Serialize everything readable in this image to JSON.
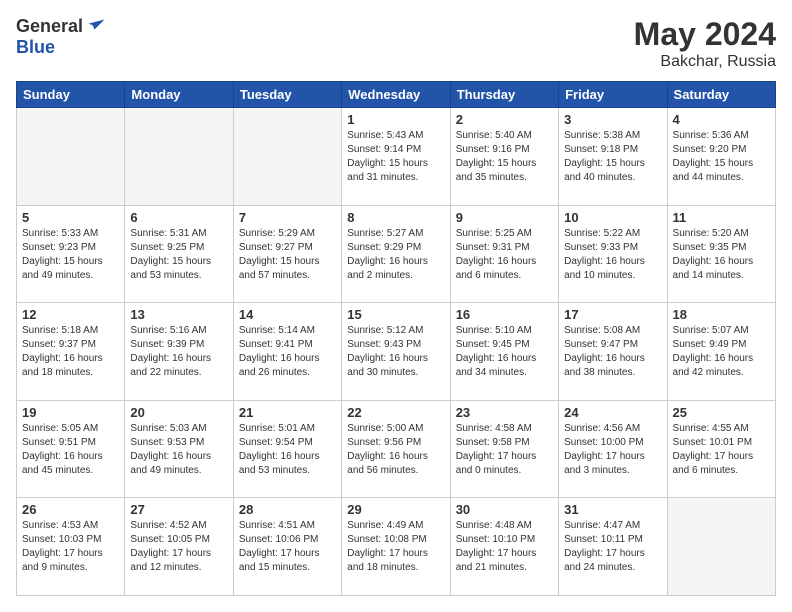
{
  "header": {
    "logo_general": "General",
    "logo_blue": "Blue",
    "month_year": "May 2024",
    "location": "Bakchar, Russia"
  },
  "days_of_week": [
    "Sunday",
    "Monday",
    "Tuesday",
    "Wednesday",
    "Thursday",
    "Friday",
    "Saturday"
  ],
  "weeks": [
    [
      {
        "day": "",
        "empty": true
      },
      {
        "day": "",
        "empty": true
      },
      {
        "day": "",
        "empty": true
      },
      {
        "day": "1",
        "sunrise": "5:43 AM",
        "sunset": "9:14 PM",
        "daylight": "15 hours and 31 minutes."
      },
      {
        "day": "2",
        "sunrise": "5:40 AM",
        "sunset": "9:16 PM",
        "daylight": "15 hours and 35 minutes."
      },
      {
        "day": "3",
        "sunrise": "5:38 AM",
        "sunset": "9:18 PM",
        "daylight": "15 hours and 40 minutes."
      },
      {
        "day": "4",
        "sunrise": "5:36 AM",
        "sunset": "9:20 PM",
        "daylight": "15 hours and 44 minutes."
      }
    ],
    [
      {
        "day": "5",
        "sunrise": "5:33 AM",
        "sunset": "9:23 PM",
        "daylight": "15 hours and 49 minutes."
      },
      {
        "day": "6",
        "sunrise": "5:31 AM",
        "sunset": "9:25 PM",
        "daylight": "15 hours and 53 minutes."
      },
      {
        "day": "7",
        "sunrise": "5:29 AM",
        "sunset": "9:27 PM",
        "daylight": "15 hours and 57 minutes."
      },
      {
        "day": "8",
        "sunrise": "5:27 AM",
        "sunset": "9:29 PM",
        "daylight": "16 hours and 2 minutes."
      },
      {
        "day": "9",
        "sunrise": "5:25 AM",
        "sunset": "9:31 PM",
        "daylight": "16 hours and 6 minutes."
      },
      {
        "day": "10",
        "sunrise": "5:22 AM",
        "sunset": "9:33 PM",
        "daylight": "16 hours and 10 minutes."
      },
      {
        "day": "11",
        "sunrise": "5:20 AM",
        "sunset": "9:35 PM",
        "daylight": "16 hours and 14 minutes."
      }
    ],
    [
      {
        "day": "12",
        "sunrise": "5:18 AM",
        "sunset": "9:37 PM",
        "daylight": "16 hours and 18 minutes."
      },
      {
        "day": "13",
        "sunrise": "5:16 AM",
        "sunset": "9:39 PM",
        "daylight": "16 hours and 22 minutes."
      },
      {
        "day": "14",
        "sunrise": "5:14 AM",
        "sunset": "9:41 PM",
        "daylight": "16 hours and 26 minutes."
      },
      {
        "day": "15",
        "sunrise": "5:12 AM",
        "sunset": "9:43 PM",
        "daylight": "16 hours and 30 minutes."
      },
      {
        "day": "16",
        "sunrise": "5:10 AM",
        "sunset": "9:45 PM",
        "daylight": "16 hours and 34 minutes."
      },
      {
        "day": "17",
        "sunrise": "5:08 AM",
        "sunset": "9:47 PM",
        "daylight": "16 hours and 38 minutes."
      },
      {
        "day": "18",
        "sunrise": "5:07 AM",
        "sunset": "9:49 PM",
        "daylight": "16 hours and 42 minutes."
      }
    ],
    [
      {
        "day": "19",
        "sunrise": "5:05 AM",
        "sunset": "9:51 PM",
        "daylight": "16 hours and 45 minutes."
      },
      {
        "day": "20",
        "sunrise": "5:03 AM",
        "sunset": "9:53 PM",
        "daylight": "16 hours and 49 minutes."
      },
      {
        "day": "21",
        "sunrise": "5:01 AM",
        "sunset": "9:54 PM",
        "daylight": "16 hours and 53 minutes."
      },
      {
        "day": "22",
        "sunrise": "5:00 AM",
        "sunset": "9:56 PM",
        "daylight": "16 hours and 56 minutes."
      },
      {
        "day": "23",
        "sunrise": "4:58 AM",
        "sunset": "9:58 PM",
        "daylight": "17 hours and 0 minutes."
      },
      {
        "day": "24",
        "sunrise": "4:56 AM",
        "sunset": "10:00 PM",
        "daylight": "17 hours and 3 minutes."
      },
      {
        "day": "25",
        "sunrise": "4:55 AM",
        "sunset": "10:01 PM",
        "daylight": "17 hours and 6 minutes."
      }
    ],
    [
      {
        "day": "26",
        "sunrise": "4:53 AM",
        "sunset": "10:03 PM",
        "daylight": "17 hours and 9 minutes."
      },
      {
        "day": "27",
        "sunrise": "4:52 AM",
        "sunset": "10:05 PM",
        "daylight": "17 hours and 12 minutes."
      },
      {
        "day": "28",
        "sunrise": "4:51 AM",
        "sunset": "10:06 PM",
        "daylight": "17 hours and 15 minutes."
      },
      {
        "day": "29",
        "sunrise": "4:49 AM",
        "sunset": "10:08 PM",
        "daylight": "17 hours and 18 minutes."
      },
      {
        "day": "30",
        "sunrise": "4:48 AM",
        "sunset": "10:10 PM",
        "daylight": "17 hours and 21 minutes."
      },
      {
        "day": "31",
        "sunrise": "4:47 AM",
        "sunset": "10:11 PM",
        "daylight": "17 hours and 24 minutes."
      },
      {
        "day": "",
        "empty": true
      }
    ]
  ]
}
